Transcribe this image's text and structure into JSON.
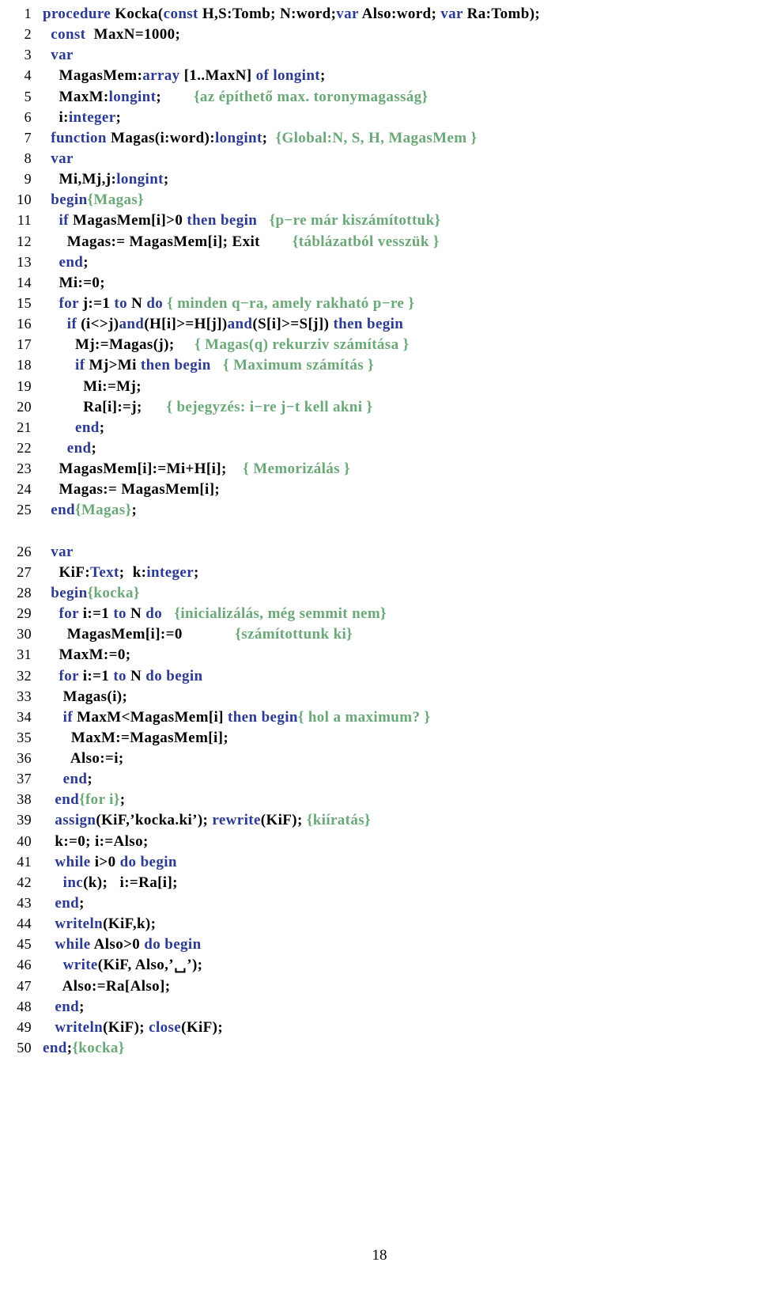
{
  "document": {
    "page_number": "18",
    "language": "Pascal",
    "colors": {
      "keyword": "#2b3a92",
      "comment": "#6aa877",
      "identifier": "#000000",
      "background": "#ffffff"
    }
  },
  "listing": {
    "lines": [
      {
        "n": "1",
        "tokens": [
          {
            "t": "kw",
            "v": "procedure"
          },
          {
            "t": "id",
            "v": " Kocka("
          },
          {
            "t": "kw",
            "v": "const"
          },
          {
            "t": "id",
            "v": " H,S:Tomb; N:word;"
          },
          {
            "t": "kw",
            "v": "var"
          },
          {
            "t": "id",
            "v": " Also:word; "
          },
          {
            "t": "kw",
            "v": "var"
          },
          {
            "t": "id",
            "v": " Ra:Tomb);"
          }
        ]
      },
      {
        "n": "2",
        "tokens": [
          {
            "t": "id",
            "v": "  "
          },
          {
            "t": "kw",
            "v": "const"
          },
          {
            "t": "id",
            "v": "  MaxN=1000;"
          }
        ]
      },
      {
        "n": "3",
        "tokens": [
          {
            "t": "id",
            "v": "  "
          },
          {
            "t": "kw",
            "v": "var"
          }
        ]
      },
      {
        "n": "4",
        "tokens": [
          {
            "t": "id",
            "v": "    MagasMem:"
          },
          {
            "t": "kw",
            "v": "array"
          },
          {
            "t": "id",
            "v": " [1..MaxN] "
          },
          {
            "t": "kw",
            "v": "of"
          },
          {
            "t": "id",
            "v": " "
          },
          {
            "t": "kw",
            "v": "longint"
          },
          {
            "t": "id",
            "v": ";"
          }
        ]
      },
      {
        "n": "5",
        "tokens": [
          {
            "t": "id",
            "v": "    MaxM:"
          },
          {
            "t": "kw",
            "v": "longint"
          },
          {
            "t": "id",
            "v": ";        "
          },
          {
            "t": "cm",
            "v": "{az építhető max. toronymagasság}"
          }
        ]
      },
      {
        "n": "6",
        "tokens": [
          {
            "t": "id",
            "v": "    i:"
          },
          {
            "t": "kw",
            "v": "integer"
          },
          {
            "t": "id",
            "v": ";"
          }
        ]
      },
      {
        "n": "7",
        "tokens": [
          {
            "t": "id",
            "v": "  "
          },
          {
            "t": "kw",
            "v": "function"
          },
          {
            "t": "id",
            "v": " Magas(i:word):"
          },
          {
            "t": "kw",
            "v": "longint"
          },
          {
            "t": "id",
            "v": ";  "
          },
          {
            "t": "cm",
            "v": "{Global:N, S, H, MagasMem }"
          }
        ]
      },
      {
        "n": "8",
        "tokens": [
          {
            "t": "id",
            "v": "  "
          },
          {
            "t": "kw",
            "v": "var"
          }
        ]
      },
      {
        "n": "9",
        "tokens": [
          {
            "t": "id",
            "v": "    Mi,Mj,j:"
          },
          {
            "t": "kw",
            "v": "longint"
          },
          {
            "t": "id",
            "v": ";"
          }
        ]
      },
      {
        "n": "10",
        "tokens": [
          {
            "t": "id",
            "v": "  "
          },
          {
            "t": "kw",
            "v": "begin"
          },
          {
            "t": "cm",
            "v": "{Magas}"
          }
        ]
      },
      {
        "n": "11",
        "tokens": [
          {
            "t": "id",
            "v": "    "
          },
          {
            "t": "kw",
            "v": "if"
          },
          {
            "t": "id",
            "v": " MagasMem[i]>0 "
          },
          {
            "t": "kw",
            "v": "then"
          },
          {
            "t": "id",
            "v": " "
          },
          {
            "t": "kw",
            "v": "begin"
          },
          {
            "t": "id",
            "v": "   "
          },
          {
            "t": "cm",
            "v": "{p−re már kiszámítottuk}"
          }
        ]
      },
      {
        "n": "12",
        "tokens": [
          {
            "t": "id",
            "v": "      Magas:= MagasMem[i]; Exit        "
          },
          {
            "t": "cm",
            "v": "{táblázatból vesszük }"
          }
        ]
      },
      {
        "n": "13",
        "tokens": [
          {
            "t": "id",
            "v": "    "
          },
          {
            "t": "kw",
            "v": "end"
          },
          {
            "t": "id",
            "v": ";"
          }
        ]
      },
      {
        "n": "14",
        "tokens": [
          {
            "t": "id",
            "v": "    Mi:=0;"
          }
        ]
      },
      {
        "n": "15",
        "tokens": [
          {
            "t": "id",
            "v": "    "
          },
          {
            "t": "kw",
            "v": "for"
          },
          {
            "t": "id",
            "v": " j:=1 "
          },
          {
            "t": "kw",
            "v": "to"
          },
          {
            "t": "id",
            "v": " N "
          },
          {
            "t": "kw",
            "v": "do"
          },
          {
            "t": "id",
            "v": " "
          },
          {
            "t": "cm",
            "v": "{ minden q−ra, amely rakható p−re }"
          }
        ]
      },
      {
        "n": "16",
        "tokens": [
          {
            "t": "id",
            "v": "      "
          },
          {
            "t": "kw",
            "v": "if"
          },
          {
            "t": "id",
            "v": " (i<>j)"
          },
          {
            "t": "kw",
            "v": "and"
          },
          {
            "t": "id",
            "v": "(H[i]>=H[j])"
          },
          {
            "t": "kw",
            "v": "and"
          },
          {
            "t": "id",
            "v": "(S[i]>=S[j]) "
          },
          {
            "t": "kw",
            "v": "then"
          },
          {
            "t": "id",
            "v": " "
          },
          {
            "t": "kw",
            "v": "begin"
          }
        ]
      },
      {
        "n": "17",
        "tokens": [
          {
            "t": "id",
            "v": "        Mj:=Magas(j);     "
          },
          {
            "t": "cm",
            "v": "{ Magas(q) rekurziv számítása }"
          }
        ]
      },
      {
        "n": "18",
        "tokens": [
          {
            "t": "id",
            "v": "        "
          },
          {
            "t": "kw",
            "v": "if"
          },
          {
            "t": "id",
            "v": " Mj>Mi "
          },
          {
            "t": "kw",
            "v": "then"
          },
          {
            "t": "id",
            "v": " "
          },
          {
            "t": "kw",
            "v": "begin"
          },
          {
            "t": "id",
            "v": "   "
          },
          {
            "t": "cm",
            "v": "{ Maximum számítás }"
          }
        ]
      },
      {
        "n": "19",
        "tokens": [
          {
            "t": "id",
            "v": "          Mi:=Mj;"
          }
        ]
      },
      {
        "n": "20",
        "tokens": [
          {
            "t": "id",
            "v": "          Ra[i]:=j;      "
          },
          {
            "t": "cm",
            "v": "{ bejegyzés: i−re j−t kell akni }"
          }
        ]
      },
      {
        "n": "21",
        "tokens": [
          {
            "t": "id",
            "v": "        "
          },
          {
            "t": "kw",
            "v": "end"
          },
          {
            "t": "id",
            "v": ";"
          }
        ]
      },
      {
        "n": "22",
        "tokens": [
          {
            "t": "id",
            "v": "      "
          },
          {
            "t": "kw",
            "v": "end"
          },
          {
            "t": "id",
            "v": ";"
          }
        ]
      },
      {
        "n": "23",
        "tokens": [
          {
            "t": "id",
            "v": "    MagasMem[i]:=Mi+H[i];    "
          },
          {
            "t": "cm",
            "v": "{ Memorizálás }"
          }
        ]
      },
      {
        "n": "24",
        "tokens": [
          {
            "t": "id",
            "v": "    Magas:= MagasMem[i];"
          }
        ]
      },
      {
        "n": "25",
        "tokens": [
          {
            "t": "id",
            "v": "  "
          },
          {
            "t": "kw",
            "v": "end"
          },
          {
            "t": "cm",
            "v": "{Magas}"
          },
          {
            "t": "id",
            "v": ";"
          }
        ]
      },
      {
        "n": "",
        "tokens": []
      },
      {
        "n": "26",
        "tokens": [
          {
            "t": "id",
            "v": "  "
          },
          {
            "t": "kw",
            "v": "var"
          }
        ]
      },
      {
        "n": "27",
        "tokens": [
          {
            "t": "id",
            "v": "    KiF:"
          },
          {
            "t": "kw",
            "v": "Text"
          },
          {
            "t": "id",
            "v": ";  k:"
          },
          {
            "t": "kw",
            "v": "integer"
          },
          {
            "t": "id",
            "v": ";"
          }
        ]
      },
      {
        "n": "28",
        "tokens": [
          {
            "t": "id",
            "v": "  "
          },
          {
            "t": "kw",
            "v": "begin"
          },
          {
            "t": "cm",
            "v": "{kocka}"
          }
        ]
      },
      {
        "n": "29",
        "tokens": [
          {
            "t": "id",
            "v": "    "
          },
          {
            "t": "kw",
            "v": "for"
          },
          {
            "t": "id",
            "v": " i:=1 "
          },
          {
            "t": "kw",
            "v": "to"
          },
          {
            "t": "id",
            "v": " N "
          },
          {
            "t": "kw",
            "v": "do"
          },
          {
            "t": "id",
            "v": "   "
          },
          {
            "t": "cm",
            "v": "{inicializálás, még semmit nem}"
          }
        ]
      },
      {
        "n": "30",
        "tokens": [
          {
            "t": "id",
            "v": "      MagasMem[i]:=0             "
          },
          {
            "t": "cm",
            "v": "{számítottunk ki}"
          }
        ]
      },
      {
        "n": "31",
        "tokens": [
          {
            "t": "id",
            "v": "    MaxM:=0;"
          }
        ]
      },
      {
        "n": "32",
        "tokens": [
          {
            "t": "id",
            "v": "    "
          },
          {
            "t": "kw",
            "v": "for"
          },
          {
            "t": "id",
            "v": " i:=1 "
          },
          {
            "t": "kw",
            "v": "to"
          },
          {
            "t": "id",
            "v": " N "
          },
          {
            "t": "kw",
            "v": "do"
          },
          {
            "t": "id",
            "v": " "
          },
          {
            "t": "kw",
            "v": "begin"
          }
        ]
      },
      {
        "n": "33",
        "tokens": [
          {
            "t": "id",
            "v": "     Magas(i);"
          }
        ]
      },
      {
        "n": "34",
        "tokens": [
          {
            "t": "id",
            "v": "     "
          },
          {
            "t": "kw",
            "v": "if"
          },
          {
            "t": "id",
            "v": " MaxM<MagasMem[i] "
          },
          {
            "t": "kw",
            "v": "then"
          },
          {
            "t": "id",
            "v": " "
          },
          {
            "t": "kw",
            "v": "begin"
          },
          {
            "t": "cm",
            "v": "{ hol a maximum? }"
          }
        ]
      },
      {
        "n": "35",
        "tokens": [
          {
            "t": "id",
            "v": "       MaxM:=MagasMem[i];"
          }
        ]
      },
      {
        "n": "36",
        "tokens": [
          {
            "t": "id",
            "v": "       Also:=i;"
          }
        ]
      },
      {
        "n": "37",
        "tokens": [
          {
            "t": "id",
            "v": "     "
          },
          {
            "t": "kw",
            "v": "end"
          },
          {
            "t": "id",
            "v": ";"
          }
        ]
      },
      {
        "n": "38",
        "tokens": [
          {
            "t": "id",
            "v": "   "
          },
          {
            "t": "kw",
            "v": "end"
          },
          {
            "t": "cm",
            "v": "{for i}"
          },
          {
            "t": "id",
            "v": ";"
          }
        ]
      },
      {
        "n": "39",
        "tokens": [
          {
            "t": "id",
            "v": "   "
          },
          {
            "t": "kw",
            "v": "assign"
          },
          {
            "t": "id",
            "v": "(KiF,"
          },
          {
            "t": "st",
            "v": "’kocka.ki’"
          },
          {
            "t": "id",
            "v": "); "
          },
          {
            "t": "kw",
            "v": "rewrite"
          },
          {
            "t": "id",
            "v": "(KiF); "
          },
          {
            "t": "cm",
            "v": "{kiíratás}"
          }
        ]
      },
      {
        "n": "40",
        "tokens": [
          {
            "t": "id",
            "v": "   k:=0; i:=Also;"
          }
        ]
      },
      {
        "n": "41",
        "tokens": [
          {
            "t": "id",
            "v": "   "
          },
          {
            "t": "kw",
            "v": "while"
          },
          {
            "t": "id",
            "v": " i>0 "
          },
          {
            "t": "kw",
            "v": "do"
          },
          {
            "t": "id",
            "v": " "
          },
          {
            "t": "kw",
            "v": "begin"
          }
        ]
      },
      {
        "n": "42",
        "tokens": [
          {
            "t": "id",
            "v": "     "
          },
          {
            "t": "kw",
            "v": "inc"
          },
          {
            "t": "id",
            "v": "(k);   i:=Ra[i];"
          }
        ]
      },
      {
        "n": "43",
        "tokens": [
          {
            "t": "id",
            "v": "   "
          },
          {
            "t": "kw",
            "v": "end"
          },
          {
            "t": "id",
            "v": ";"
          }
        ]
      },
      {
        "n": "44",
        "tokens": [
          {
            "t": "id",
            "v": "   "
          },
          {
            "t": "kw",
            "v": "writeln"
          },
          {
            "t": "id",
            "v": "(KiF,k);"
          }
        ]
      },
      {
        "n": "45",
        "tokens": [
          {
            "t": "id",
            "v": "   "
          },
          {
            "t": "kw",
            "v": "while"
          },
          {
            "t": "id",
            "v": " Also>0 "
          },
          {
            "t": "kw",
            "v": "do"
          },
          {
            "t": "id",
            "v": " "
          },
          {
            "t": "kw",
            "v": "begin"
          }
        ]
      },
      {
        "n": "46",
        "tokens": [
          {
            "t": "id",
            "v": "     "
          },
          {
            "t": "kw",
            "v": "write"
          },
          {
            "t": "id",
            "v": "(KiF, Also,"
          },
          {
            "t": "st",
            "v": "’␣’"
          },
          {
            "t": "id",
            "v": ");"
          }
        ]
      },
      {
        "n": "47",
        "tokens": [
          {
            "t": "id",
            "v": "     Also:=Ra[Also];"
          }
        ]
      },
      {
        "n": "48",
        "tokens": [
          {
            "t": "id",
            "v": "   "
          },
          {
            "t": "kw",
            "v": "end"
          },
          {
            "t": "id",
            "v": ";"
          }
        ]
      },
      {
        "n": "49",
        "tokens": [
          {
            "t": "id",
            "v": "   "
          },
          {
            "t": "kw",
            "v": "writeln"
          },
          {
            "t": "id",
            "v": "(KiF); "
          },
          {
            "t": "kw",
            "v": "close"
          },
          {
            "t": "id",
            "v": "(KiF);"
          }
        ]
      },
      {
        "n": "50",
        "tokens": [
          {
            "t": "kw",
            "v": "end"
          },
          {
            "t": "id",
            "v": ";"
          },
          {
            "t": "cm",
            "v": "{kocka}"
          }
        ]
      }
    ]
  }
}
